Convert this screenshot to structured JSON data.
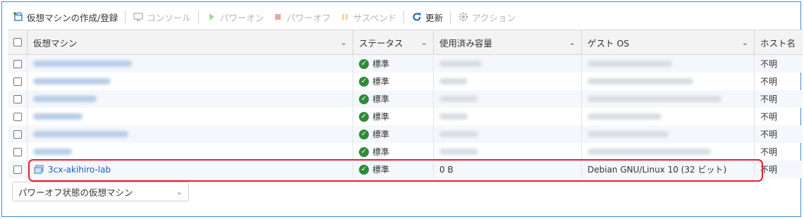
{
  "toolbar": {
    "create_register": "仮想マシンの作成/登録",
    "console": "コンソール",
    "power_on": "パワーオン",
    "power_off": "パワーオフ",
    "suspend": "サスペンド",
    "refresh": "更新",
    "actions": "アクション"
  },
  "columns": {
    "vm": "仮想マシン",
    "status": "ステータス",
    "used_storage": "使用済み容量",
    "guest_os": "ゲスト OS",
    "host_name": "ホスト名"
  },
  "rows": [
    {
      "name": "",
      "status": "標準",
      "used": "",
      "os": "",
      "host": "不明",
      "blurred": true
    },
    {
      "name": "",
      "status": "標準",
      "used": "",
      "os": "",
      "host": "不明",
      "blurred": true
    },
    {
      "name": "",
      "status": "標準",
      "used": "",
      "os": "",
      "host": "不明",
      "blurred": true
    },
    {
      "name": "",
      "status": "標準",
      "used": "",
      "os": "",
      "host": "不明",
      "blurred": true
    },
    {
      "name": "",
      "status": "標準",
      "used": "",
      "os": "",
      "host": "不明",
      "blurred": true
    },
    {
      "name": "",
      "status": "標準",
      "used": "",
      "os": "",
      "host": "不明",
      "blurred": true
    },
    {
      "name": "3cx-akihiro-lab",
      "status": "標準",
      "used": "0 B",
      "os": "Debian GNU/Linux 10 (32 ビット)",
      "host": "不明",
      "blurred": false
    }
  ],
  "filter": {
    "selected": "パワーオフ状態の仮想マシン"
  },
  "colors": {
    "accent": "#3b8ad9",
    "highlight": "#e8202a",
    "status_ok": "#2e8b3a"
  }
}
